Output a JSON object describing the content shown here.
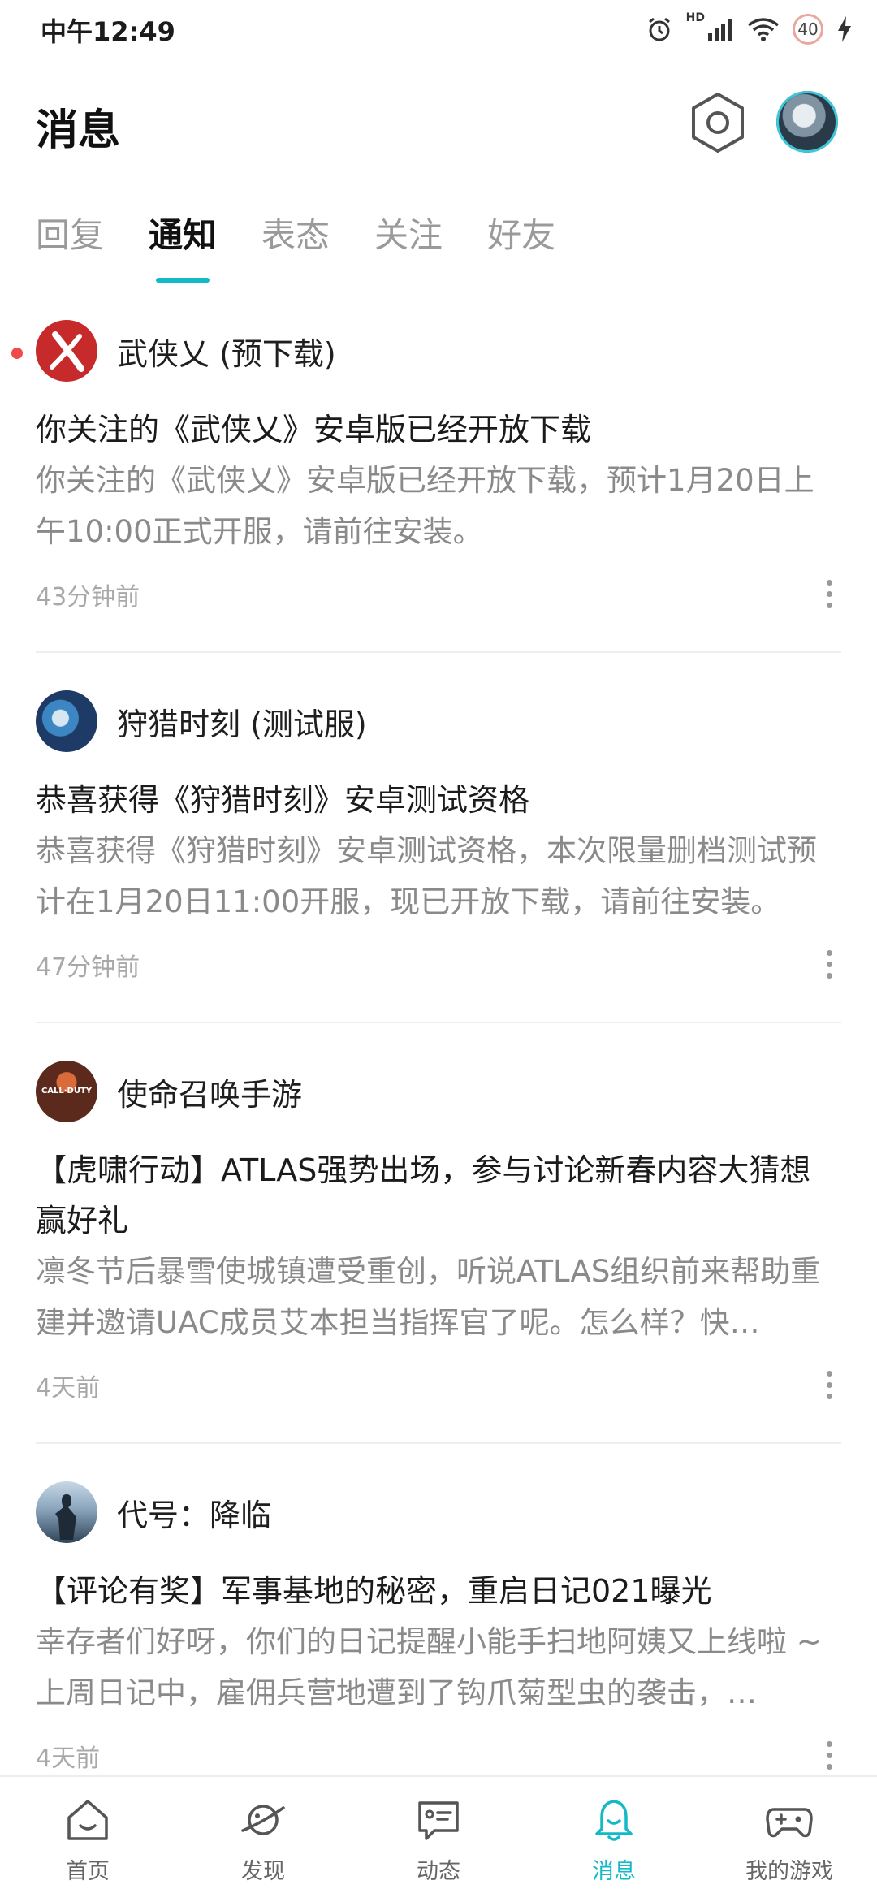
{
  "status": {
    "time": "中午12:49",
    "network": "HD",
    "battery": "40",
    "icons": [
      "alarm-icon",
      "signal-icon",
      "wifi-icon",
      "battery-icon",
      "charging-icon"
    ]
  },
  "header": {
    "title": "消息",
    "settings_icon": "hexagon-gear-icon",
    "avatar": "user-avatar"
  },
  "tabs": [
    {
      "label": "回复",
      "active": false
    },
    {
      "label": "通知",
      "active": true
    },
    {
      "label": "表态",
      "active": false
    },
    {
      "label": "关注",
      "active": false
    },
    {
      "label": "好友",
      "active": false
    }
  ],
  "notifications": [
    {
      "source": "武侠乂 (预下载)",
      "title": "你关注的《武侠乂》安卓版已经开放下载",
      "body": "你关注的《武侠乂》安卓版已经开放下载，预计1月20日上午10:00正式开服，请前往安装。",
      "time": "43分钟前",
      "unread": true
    },
    {
      "source": "狩猎时刻 (测试服)",
      "title": "恭喜获得《狩猎时刻》安卓测试资格",
      "body": "恭喜获得《狩猎时刻》安卓测试资格，本次限量删档测试预计在1月20日11:00开服，现已开放下载，请前往安装。",
      "time": "47分钟前",
      "unread": false
    },
    {
      "source": "使命召唤手游",
      "logo_text": "CALL·DUTY",
      "title": "【虎啸行动】ATLAS强势出场，参与讨论新春内容大猜想赢好礼",
      "body": "凛冬节后暴雪使城镇遭受重创，听说ATLAS组织前来帮助重建并邀请UAC成员艾本担当指挥官了呢。怎么样？快…",
      "time": "4天前",
      "unread": false
    },
    {
      "source": "代号：降临",
      "title": "【评论有奖】军事基地的秘密，重启日记021曝光",
      "body": "幸存者们好呀，你们的日记提醒小能手扫地阿姨又上线啦 ~ 上周日记中，雇佣兵营地遭到了钩爪菊型虫的袭击，…",
      "time": "4天前",
      "unread": false
    }
  ],
  "bottom_nav": [
    {
      "label": "首页",
      "icon": "home-icon",
      "active": false
    },
    {
      "label": "发现",
      "icon": "planet-icon",
      "active": false
    },
    {
      "label": "动态",
      "icon": "chat-card-icon",
      "active": false
    },
    {
      "label": "消息",
      "icon": "bell-icon",
      "active": true
    },
    {
      "label": "我的游戏",
      "icon": "gamepad-icon",
      "active": false
    }
  ],
  "colors": {
    "accent": "#14b9c8",
    "unread_dot": "#f04b4b",
    "text_primary": "#1b1b1b",
    "text_secondary": "#8a8a8a"
  }
}
